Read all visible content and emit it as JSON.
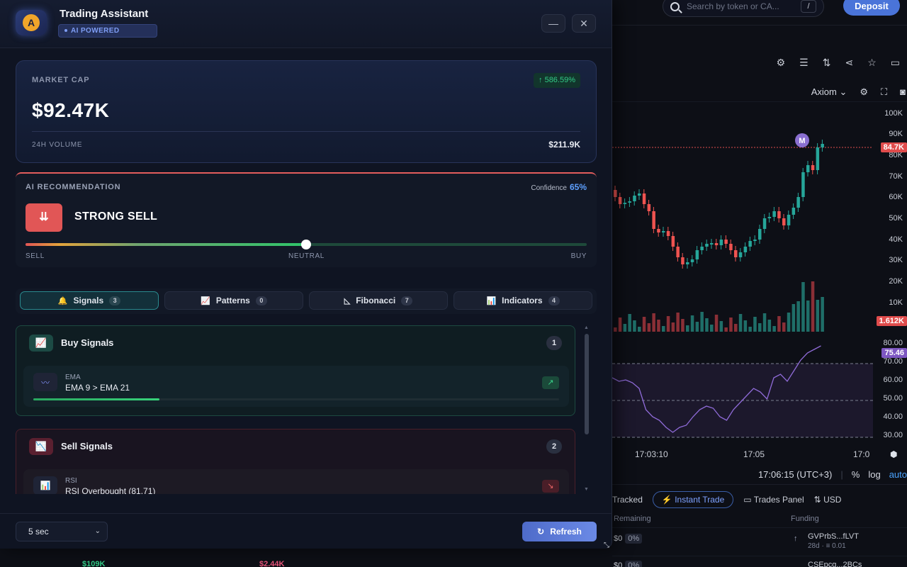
{
  "header": {
    "title": "Trading Assistant",
    "badge": "AI POWERED",
    "logo_letter": "A",
    "minimize": "—",
    "close": "✕"
  },
  "market_cap": {
    "label": "MARKET CAP",
    "value": "$92.47K",
    "change": "↑ 586.59%",
    "volume_label": "24H VOLUME",
    "volume_value": "$211.9K"
  },
  "recommendation": {
    "label": "AI RECOMMENDATION",
    "confidence_label": "Confidence",
    "confidence_value": "65%",
    "signal_icon": "⇊",
    "signal": "STRONG SELL",
    "meter_level": 0.5,
    "scale_sell": "SELL",
    "scale_neutral": "NEUTRAL",
    "scale_buy": "BUY"
  },
  "tabs": [
    {
      "label": "Signals",
      "count": "3",
      "icon": "🔔",
      "active": true
    },
    {
      "label": "Patterns",
      "count": "0",
      "icon": "📈",
      "active": false
    },
    {
      "label": "Fibonacci",
      "count": "7",
      "icon": "◺",
      "active": false
    },
    {
      "label": "Indicators",
      "count": "4",
      "icon": "📊",
      "active": false
    }
  ],
  "buy_signals": {
    "title": "Buy Signals",
    "count": "1",
    "items": [
      {
        "type": "EMA",
        "description": "EMA 9 > EMA 21",
        "direction": "↗",
        "strength": 0.24
      }
    ]
  },
  "sell_signals": {
    "title": "Sell Signals",
    "count": "2",
    "items": [
      {
        "type": "RSI",
        "description": "RSI Overbought (81.71)",
        "direction": "↘"
      }
    ]
  },
  "footer": {
    "interval": "5 sec",
    "refresh_label": "Refresh",
    "refresh_icon": "↻"
  },
  "background": {
    "search_placeholder": "Search by token or CA...",
    "search_shortcut": "/",
    "deposit_label": "Deposit",
    "chart_source": "Axiom",
    "price_ticks": [
      "100K",
      "90K",
      "80K",
      "70K",
      "60K",
      "50K",
      "40K",
      "30K",
      "20K",
      "10K"
    ],
    "last_price_tag": "84.7K",
    "volume_tag": "1.612K",
    "rsi_ticks": [
      "80.00",
      "70.00",
      "60.00",
      "50.00",
      "40.00",
      "30.00"
    ],
    "rsi_tag": "75.46",
    "marker_label": "M",
    "time_ticks": [
      "17:03:10",
      "17:05",
      "17:0"
    ],
    "clock": "17:06:15 (UTC+3)",
    "scale_percent": "%",
    "scale_log": "log",
    "scale_auto": "auto",
    "tab_tracked": "Tracked",
    "tab_instant": "Instant Trade",
    "tab_trades_panel": "Trades Panel",
    "tab_currency": "USD",
    "col_remaining": "Remaining",
    "col_funding": "Funding",
    "row1_remaining": "$0",
    "row1_pct": "0%",
    "row1_token": "GVPrbS...fLVT",
    "row1_meta": "28d · ≡ 0.01",
    "row2_remaining": "$0",
    "row2_pct": "0%",
    "row2_token": "CSEpcg...2BCs",
    "under_left": "$109K",
    "under_right": "$2.44K"
  }
}
